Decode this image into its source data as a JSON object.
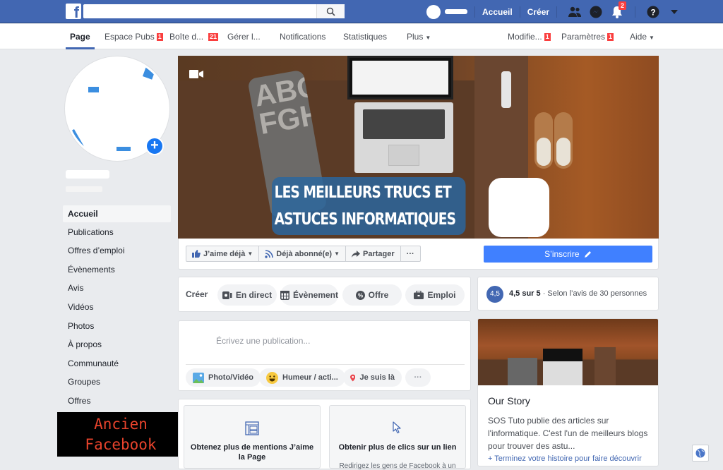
{
  "topbar": {
    "logo": "f",
    "search_value": "",
    "search_placeholder": "",
    "links": [
      "Accueil",
      "Créer"
    ],
    "notifications_badge": "2",
    "icons": [
      "friends-icon",
      "messenger-icon",
      "notifications-icon",
      "help-icon",
      "account-menu-caret"
    ]
  },
  "subnav": {
    "items": [
      {
        "label": "Page",
        "badge": null,
        "active": true
      },
      {
        "label": "Espace Pubs",
        "badge": "1"
      },
      {
        "label": "Boîte d...",
        "badge": "21"
      },
      {
        "label": "Gérer l...",
        "badge": null
      },
      {
        "label": "Notifications",
        "badge": null
      },
      {
        "label": "Statistiques",
        "badge": null
      },
      {
        "label": "Plus",
        "caret": true
      }
    ],
    "right_items": [
      {
        "label": "Modifie...",
        "badge": "1"
      },
      {
        "label": "Paramètres",
        "badge": "1"
      },
      {
        "label": "Aide",
        "caret": true
      }
    ]
  },
  "sidebar": {
    "items": [
      {
        "label": "Accueil",
        "active": true
      },
      {
        "label": "Publications"
      },
      {
        "label": "Offres d’emploi"
      },
      {
        "label": "Évènements"
      },
      {
        "label": "Avis"
      },
      {
        "label": "Vidéos"
      },
      {
        "label": "Photos"
      },
      {
        "label": "À propos"
      },
      {
        "label": "Communauté"
      },
      {
        "label": "Groupes"
      },
      {
        "label": "Offres"
      }
    ]
  },
  "overlay_label": {
    "line1": "Ancien",
    "line2": "Facebook",
    "color": "#e8432c"
  },
  "cover": {
    "banner_line1": "LES MEILLEURS TRUCS ET",
    "banner_line2": "ASTUCES INFORMATIQUES",
    "pillow_text": "ABCDE FGHIJK"
  },
  "actions": {
    "like": "J’aime déjà",
    "follow": "Déjà abonné(e)",
    "share": "Partager",
    "more": "···",
    "signup": "S’inscrire"
  },
  "create": {
    "label": "Créer",
    "buttons": [
      "En direct",
      "Évènement",
      "Offre",
      "Emploi"
    ]
  },
  "rating": {
    "score": "4,5",
    "bold": "4,5 sur 5",
    "text": " · Selon l’avis de 30 personnes"
  },
  "composer": {
    "placeholder": "Écrivez une publication...",
    "buttons": [
      "Photo/Vidéo",
      "Humeur / acti...",
      "Je suis là",
      "···"
    ]
  },
  "promos": [
    {
      "title": "Obtenez plus de mentions J’aime la Page",
      "desc": ""
    },
    {
      "title": "Obtenir plus de clics sur un lien",
      "desc": "Redirigez les gens de Facebook à un"
    }
  ],
  "story": {
    "title": "Our Story",
    "body": "SOS Tuto publie des articles sur l'informatique. C'est l'un de meilleurs blogs pour trouver des astu...",
    "link": "+ Terminez votre histoire pour faire découvrir"
  },
  "colors": {
    "brand": "#4267b2",
    "cta": "#4080ff",
    "badge": "#fa3e3e"
  }
}
